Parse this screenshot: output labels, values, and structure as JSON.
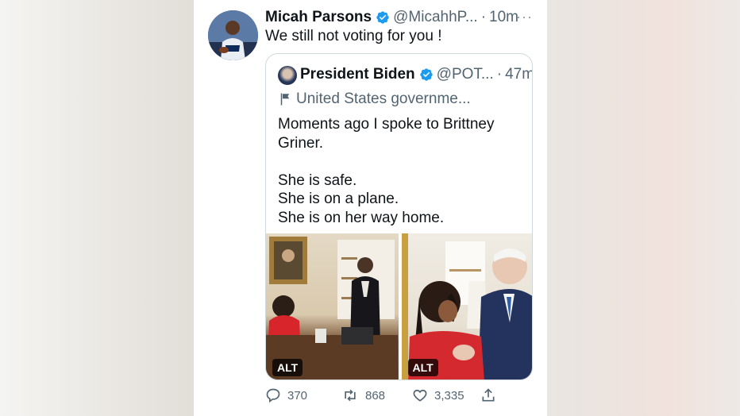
{
  "tweet": {
    "author_name": "Micah Parsons",
    "handle": "@MicahhP...",
    "dot": "·",
    "time": "10m",
    "text": "We still not voting for you !",
    "more_label": "···"
  },
  "quote": {
    "author_name": "President Biden",
    "handle": "@POT...",
    "dot": "·",
    "time": "47m",
    "affiliation": "United States governme...",
    "lines": [
      "Moments ago I spoke to Brittney Griner.",
      "She is safe.",
      "She is on a plane.",
      "She is on her way home."
    ],
    "photos": [
      {
        "alt_label": "ALT"
      },
      {
        "alt_label": "ALT"
      }
    ]
  },
  "actions": {
    "replies": "370",
    "retweets": "868",
    "likes": "3,335"
  },
  "colors": {
    "verified": "#1d9bf0",
    "text": "#0f1419",
    "secondary": "#536471",
    "border": "#cfd9de"
  },
  "icons": [
    "verified-badge-icon",
    "more-icon",
    "flag-icon",
    "reply-icon",
    "retweet-icon",
    "like-icon",
    "share-icon"
  ]
}
